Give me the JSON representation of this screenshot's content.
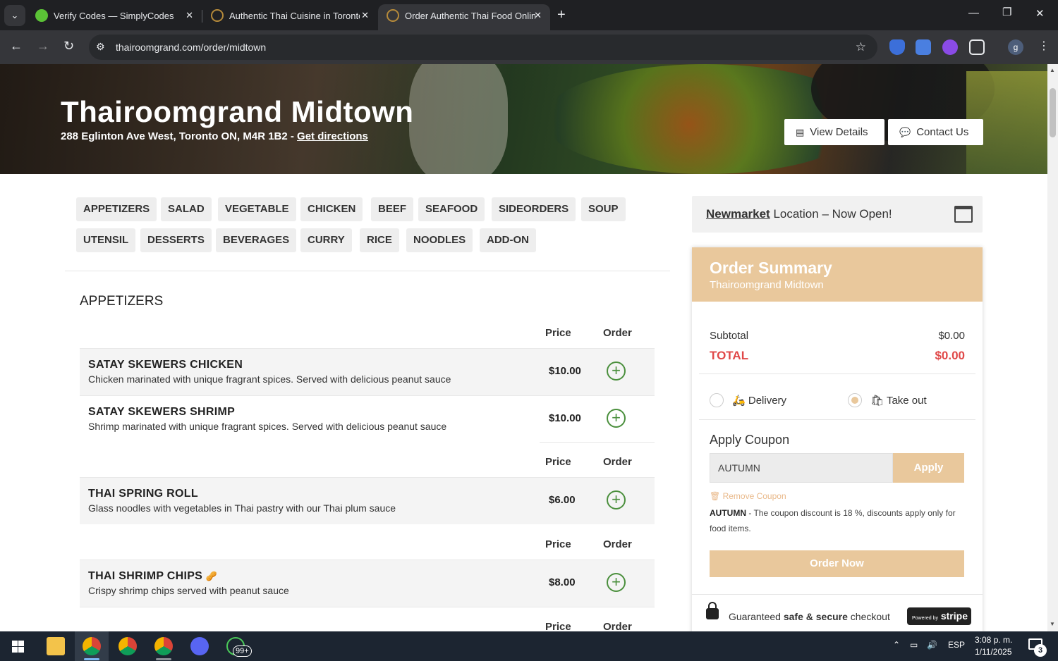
{
  "browser": {
    "tabs": [
      {
        "title": "Verify Codes — SimplyCodes",
        "favicon_color": "#5bc236"
      },
      {
        "title": "Authentic Thai Cuisine in Toronto",
        "favicon_color": "#b58a3a"
      },
      {
        "title": "Order Authentic Thai Food Online",
        "favicon_color": "#b58a3a"
      }
    ],
    "url": "thairoomgrand.com/order/midtown",
    "profile_initial": "g"
  },
  "hero": {
    "title": "Thairoomgrand Midtown",
    "address": "288 Eglinton Ave West, Toronto ON, M4R 1B2 - ",
    "directions_link": "Get directions",
    "view_details_label": "View Details",
    "contact_label": "Contact Us"
  },
  "categories": [
    [
      "APPETIZERS",
      "SALAD",
      "VEGETABLE",
      "CHICKEN",
      "BEEF",
      "SEAFOOD",
      "SIDEORDERS",
      "SOUP"
    ],
    [
      "UTENSIL",
      "DESSERTS",
      "BEVERAGES",
      "CURRY",
      "RICE",
      "NOODLES",
      "ADD-ON"
    ]
  ],
  "menu": {
    "section_title": "APPETIZERS",
    "price_header": "Price",
    "order_header": "Order",
    "items": [
      {
        "name": "SATAY SKEWERS CHICKEN",
        "desc": "Chicken marinated with unique fragrant spices. Served with delicious peanut sauce",
        "price": "$10.00"
      },
      {
        "name": "SATAY SKEWERS SHRIMP",
        "desc": "Shrimp marinated with unique fragrant spices. Served with delicious peanut sauce",
        "price": "$10.00"
      },
      {
        "name": "THAI SPRING ROLL",
        "desc": "Glass noodles with vegetables in Thai pastry with our Thai plum sauce",
        "price": "$6.00"
      },
      {
        "name": "THAI SHRIMP CHIPS",
        "desc": "Crispy shrimp chips served with peanut sauce",
        "price": "$8.00"
      }
    ]
  },
  "promo": {
    "location": "Newmarket",
    "text": " Location – Now Open!"
  },
  "summary": {
    "title": "Order Summary",
    "subtitle": "Thairoomgrand Midtown",
    "subtotal_label": "Subtotal",
    "subtotal_value": "$0.00",
    "total_label": "TOTAL",
    "total_value": "$0.00",
    "delivery_label": "Delivery",
    "takeout_label": "Take out",
    "selected_option": "Take out",
    "coupon_title": "Apply Coupon",
    "coupon_value": "AUTUMN",
    "apply_label": "Apply",
    "remove_label": "Remove Coupon",
    "coupon_code": "AUTUMN",
    "coupon_note": " - The coupon discount is 18 %, discounts apply only for food items.",
    "order_now_label": "Order Now",
    "secure_prefix": "Guaranteed ",
    "secure_bold": "safe & secure",
    "secure_suffix": " checkout",
    "stripe_small": "Powered by",
    "stripe_label": "stripe"
  },
  "taskbar": {
    "language": "ESP",
    "time": "3:08 p. m.",
    "date": "1/11/2025",
    "whatsapp_badge": "99+",
    "notifications": "3"
  },
  "colors": {
    "accent": "#e9c89c",
    "total_red": "#e04848",
    "add_green": "#4a8f3c"
  }
}
